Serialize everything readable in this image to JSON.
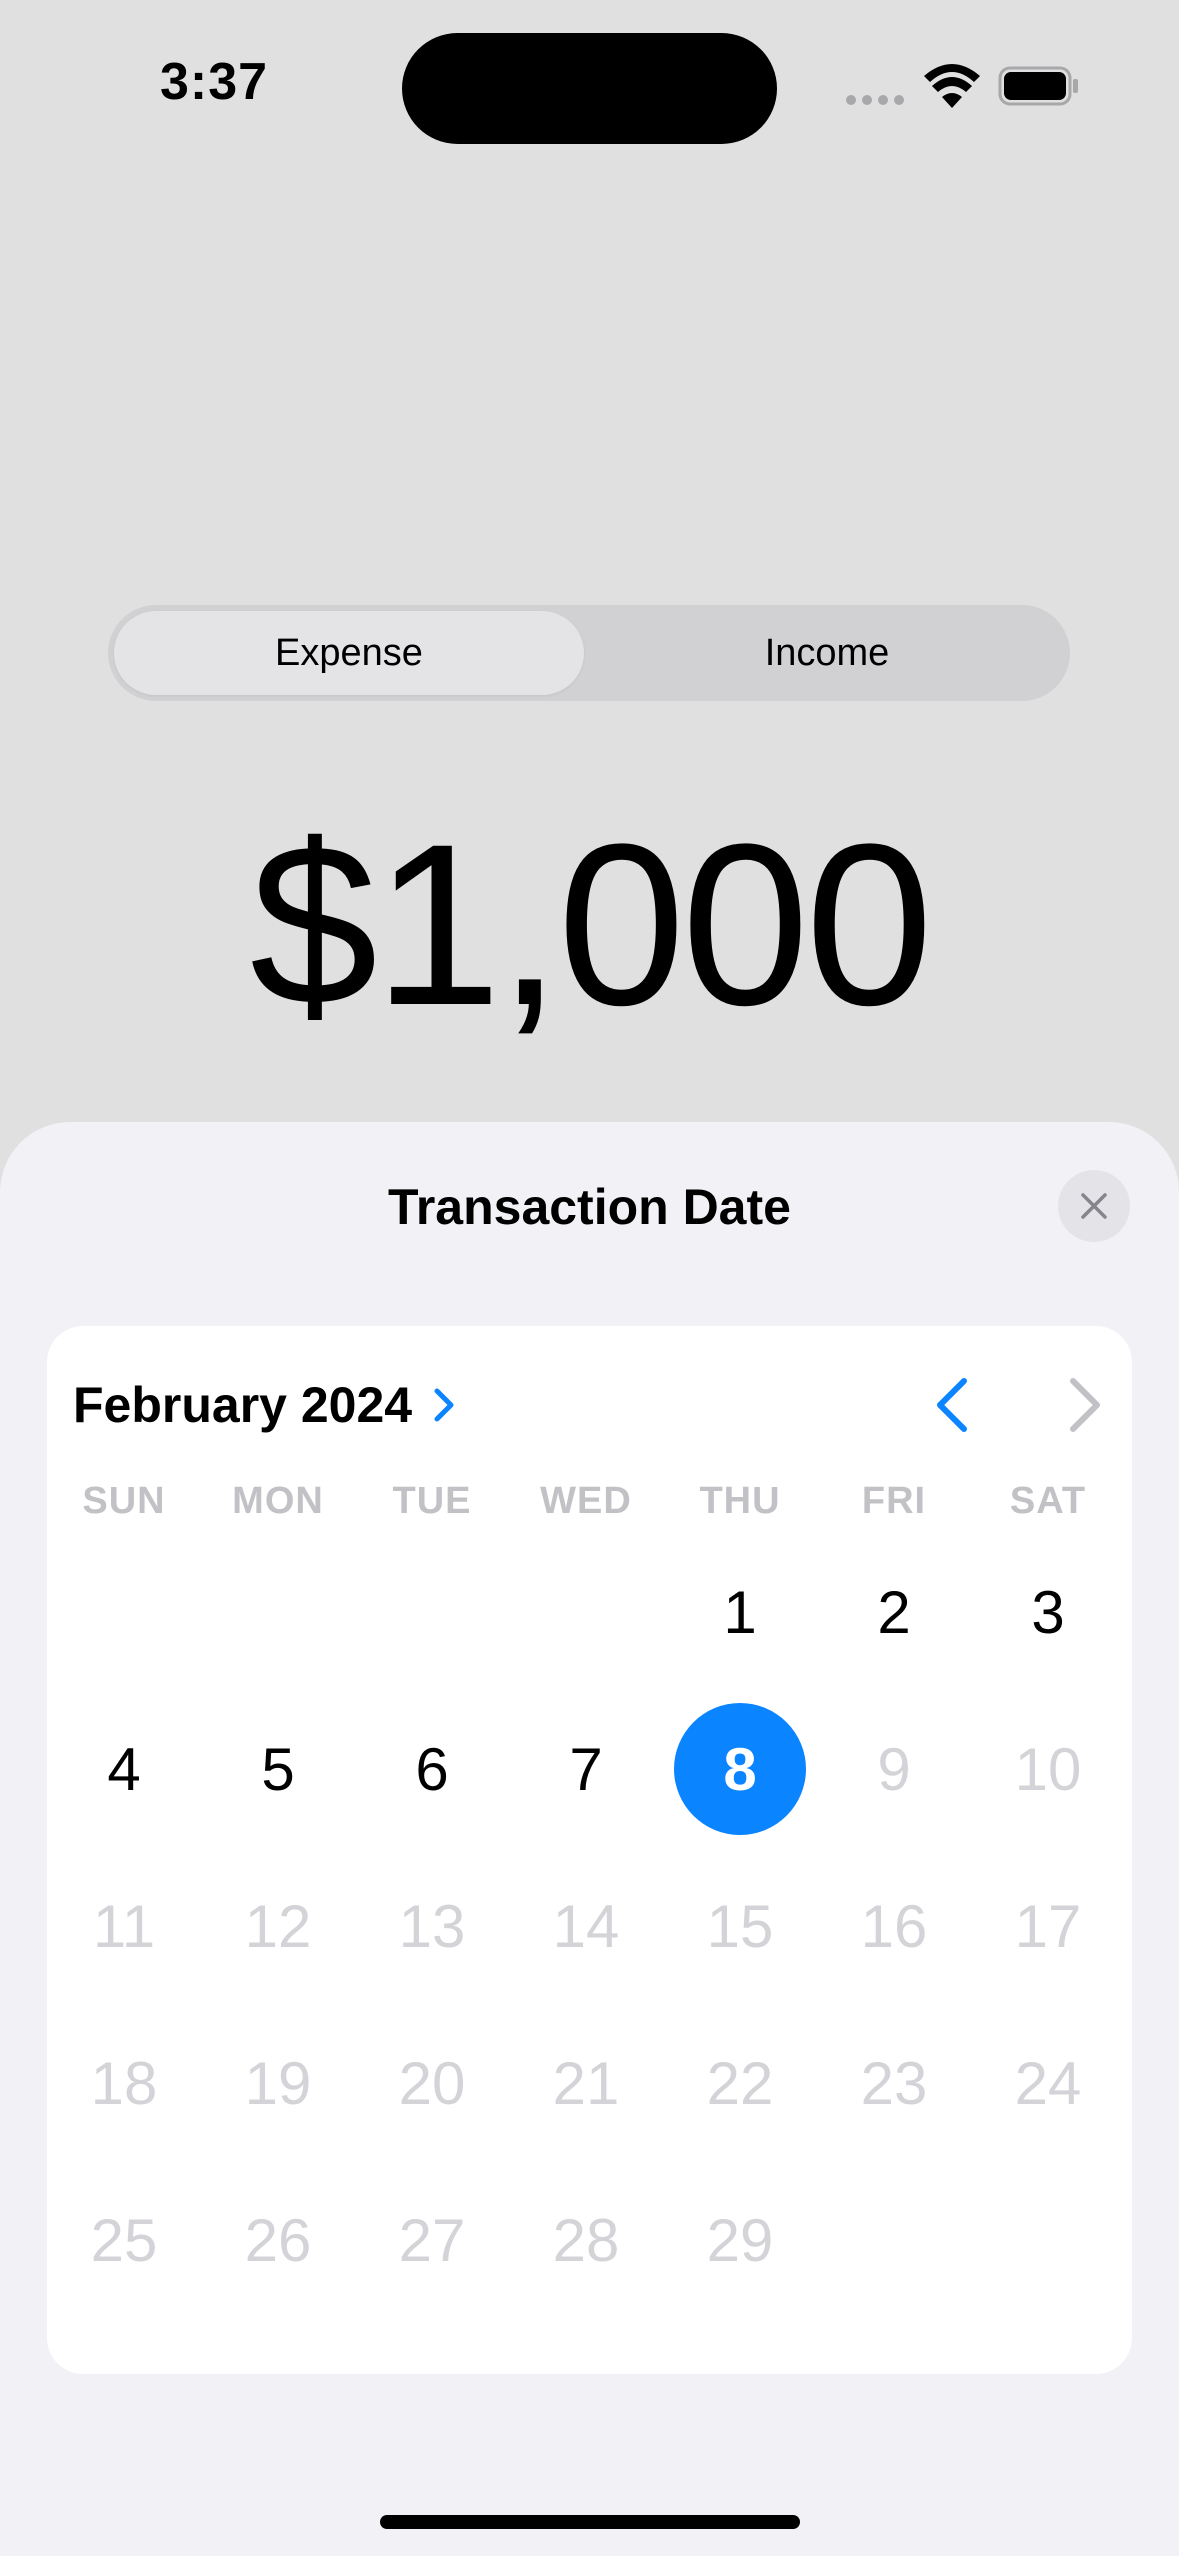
{
  "status_bar": {
    "time": "3:37"
  },
  "transaction_type": {
    "options": [
      "Expense",
      "Income"
    ],
    "selected": "Expense"
  },
  "amount": "$1,000",
  "sheet": {
    "title": "Transaction Date"
  },
  "calendar": {
    "month_label": "February 2024",
    "weekdays": [
      "SUN",
      "MON",
      "TUE",
      "WED",
      "THU",
      "FRI",
      "SAT"
    ],
    "first_weekday_index": 4,
    "days_in_month": 29,
    "selected_day": 8,
    "last_enabled_day": 8
  },
  "colors": {
    "accent": "#0a84ff",
    "disabled_day": "#d4d4d8",
    "sheet_background": "#f1f1f6",
    "page_background": "#e0e0e1"
  },
  "icons": {
    "close": "close-icon",
    "month_chevron": "chevron-right-icon",
    "prev": "chevron-left-icon",
    "next": "chevron-right-icon",
    "wifi": "wifi-icon",
    "battery": "battery-icon"
  }
}
